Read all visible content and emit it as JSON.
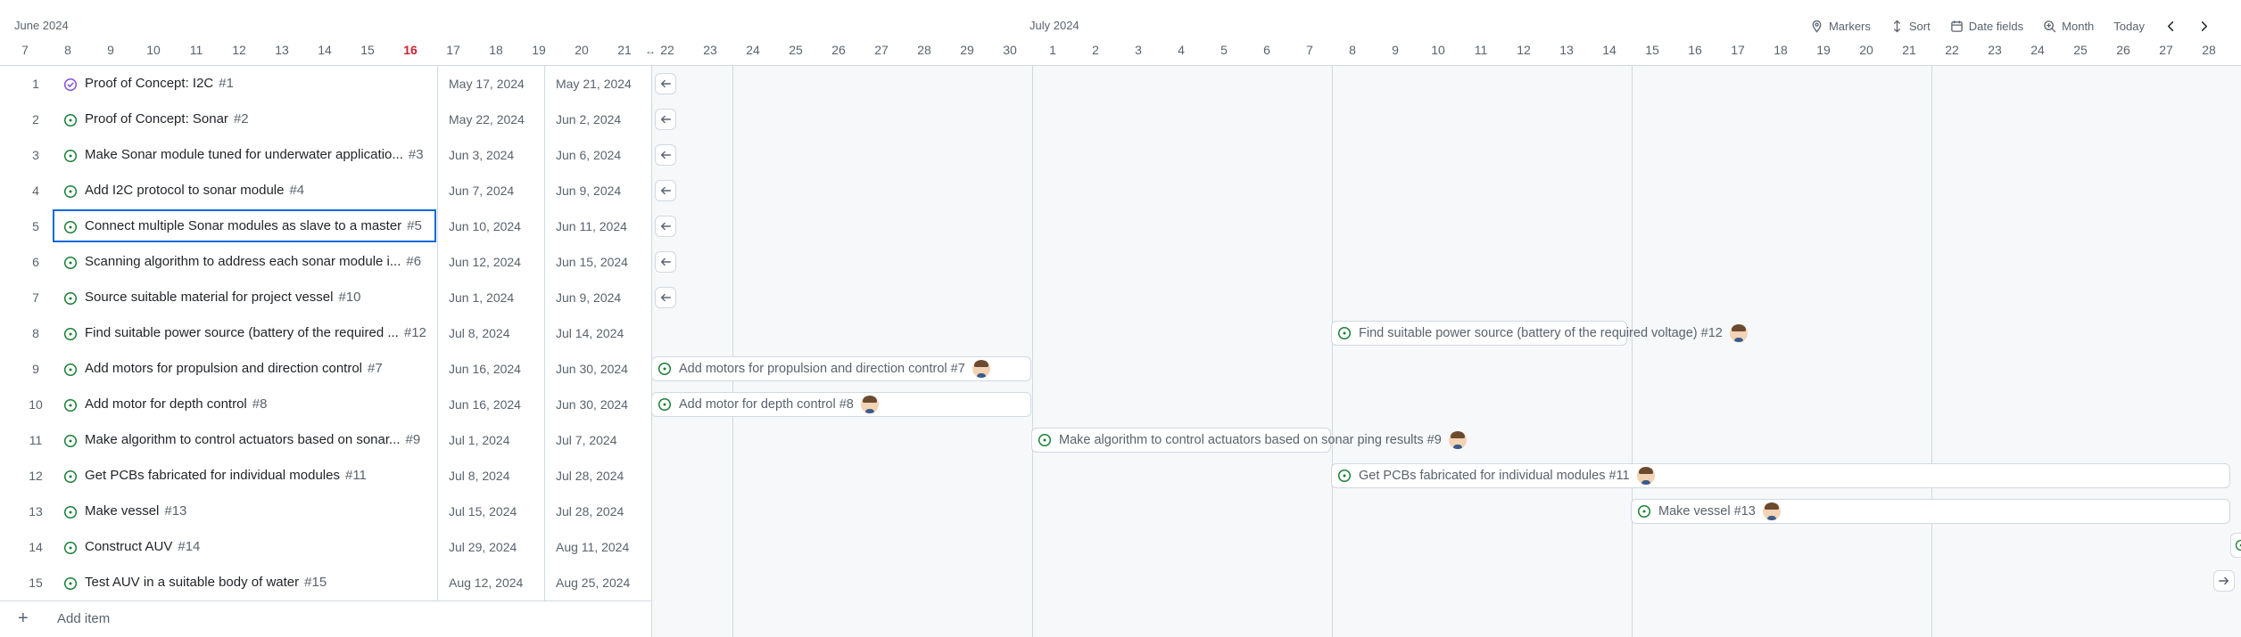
{
  "header": {
    "month_left": "June 2024",
    "month_mid": "July 2024",
    "days": [
      "7",
      "8",
      "9",
      "10",
      "11",
      "12",
      "13",
      "14",
      "15",
      "16",
      "17",
      "18",
      "19",
      "20",
      "21",
      "22",
      "23",
      "24",
      "25",
      "26",
      "27",
      "28",
      "29",
      "30",
      "1",
      "2",
      "3",
      "4",
      "5",
      "6",
      "7",
      "8",
      "9",
      "10",
      "11",
      "12",
      "13",
      "14",
      "15",
      "16",
      "17",
      "18",
      "19",
      "20",
      "21",
      "22",
      "23",
      "24",
      "25",
      "26",
      "27",
      "28"
    ],
    "today": "16"
  },
  "toolbar": {
    "markers": "Markers",
    "sort": "Sort",
    "date_fields": "Date fields",
    "zoom": "Month",
    "today": "Today"
  },
  "colors": {
    "open": "#1a7f37",
    "done": "#8250df",
    "focus": "#0969da",
    "today": "#cf222e"
  },
  "rows": [
    {
      "num": "1",
      "title": "Proof of Concept: I2C",
      "id": "#1",
      "start": "May 17, 2024",
      "end": "May 21, 2024",
      "status": "done"
    },
    {
      "num": "2",
      "title": "Proof of Concept: Sonar",
      "id": "#2",
      "start": "May 22, 2024",
      "end": "Jun 2, 2024",
      "status": "open"
    },
    {
      "num": "3",
      "title": "Make Sonar module tuned for underwater applicatio...",
      "id": "#3",
      "start": "Jun 3, 2024",
      "end": "Jun 6, 2024",
      "status": "open"
    },
    {
      "num": "4",
      "title": "Add I2C protocol to sonar module",
      "id": "#4",
      "start": "Jun 7, 2024",
      "end": "Jun 9, 2024",
      "status": "open"
    },
    {
      "num": "5",
      "title": "Connect multiple Sonar modules as slave to a master",
      "id": "#5",
      "start": "Jun 10, 2024",
      "end": "Jun 11, 2024",
      "status": "open"
    },
    {
      "num": "6",
      "title": "Scanning algorithm to address each sonar module i...",
      "id": "#6",
      "start": "Jun 12, 2024",
      "end": "Jun 15, 2024",
      "status": "open"
    },
    {
      "num": "7",
      "title": "Source suitable material for project vessel",
      "id": "#10",
      "start": "Jun 1, 2024",
      "end": "Jun 9, 2024",
      "status": "open"
    },
    {
      "num": "8",
      "title": "Find suitable power source (battery of the required ...",
      "id": "#12",
      "start": "Jul 8, 2024",
      "end": "Jul 14, 2024",
      "status": "open"
    },
    {
      "num": "9",
      "title": "Add motors for propulsion and direction control",
      "id": "#7",
      "start": "Jun 16, 2024",
      "end": "Jun 30, 2024",
      "status": "open"
    },
    {
      "num": "10",
      "title": "Add motor for depth control",
      "id": "#8",
      "start": "Jun 16, 2024",
      "end": "Jun 30, 2024",
      "status": "open"
    },
    {
      "num": "11",
      "title": "Make algorithm to control actuators based on sonar...",
      "id": "#9",
      "start": "Jul 1, 2024",
      "end": "Jul 7, 2024",
      "status": "open"
    },
    {
      "num": "12",
      "title": "Get PCBs fabricated for individual modules",
      "id": "#11",
      "start": "Jul 8, 2024",
      "end": "Jul 28, 2024",
      "status": "open"
    },
    {
      "num": "13",
      "title": "Make vessel",
      "id": "#13",
      "start": "Jul 15, 2024",
      "end": "Jul 28, 2024",
      "status": "open"
    },
    {
      "num": "14",
      "title": "Construct AUV",
      "id": "#14",
      "start": "Jul 29, 2024",
      "end": "Aug 11, 2024",
      "status": "open"
    },
    {
      "num": "15",
      "title": "Test AUV in a suitable body of water",
      "id": "#15",
      "start": "Aug 12, 2024",
      "end": "Aug 25, 2024",
      "status": "open"
    }
  ],
  "bars": [
    {
      "row": 8,
      "label": "Find suitable power source (battery of the required voltage) #12"
    },
    {
      "row": 9,
      "label": "Add motors for propulsion and direction control #7"
    },
    {
      "row": 10,
      "label": "Add motor for depth control #8"
    },
    {
      "row": 11,
      "label": "Make algorithm to control actuators based on sonar ping results #9"
    },
    {
      "row": 12,
      "label": "Get PCBs fabricated for individual modules #11"
    },
    {
      "row": 13,
      "label": "Make vessel #13"
    }
  ],
  "add_item": "Add item"
}
